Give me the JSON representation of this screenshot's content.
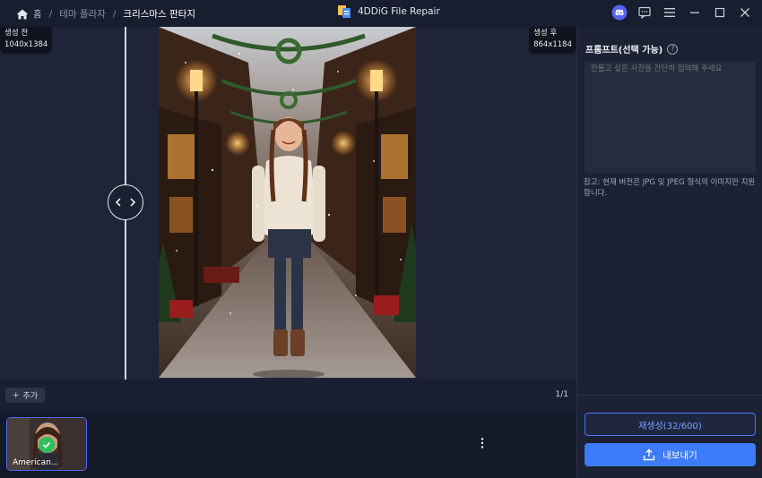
{
  "titlebar": {
    "breadcrumbs": [
      "홈",
      "테마 플라자",
      "크리스마스 판타지"
    ],
    "app_title": "4DDiG File Repair"
  },
  "compare": {
    "before_label": "생성 전",
    "before_size": "1040x1384",
    "after_label": "생성 후",
    "after_size": "864x1184"
  },
  "toolbar": {
    "add_label": "추가",
    "pager": "1/1"
  },
  "thumbnails": [
    {
      "label": "American..."
    }
  ],
  "panel": {
    "prompt_label": "프롬프트(선택 가능)",
    "prompt_placeholder": "만들고 싶은 사진을 간단히 입력해 주세요",
    "note": "참고: 현재 버전은 JPG 및 JPEG 형식의 이미지만 지원합니다.",
    "regenerate_label": "재생성(32/600)",
    "export_label": "내보내기"
  },
  "colors": {
    "accent": "#3d7bf8",
    "background": "#151a2b",
    "panel": "#1c2134",
    "success": "#2fbf5b"
  }
}
